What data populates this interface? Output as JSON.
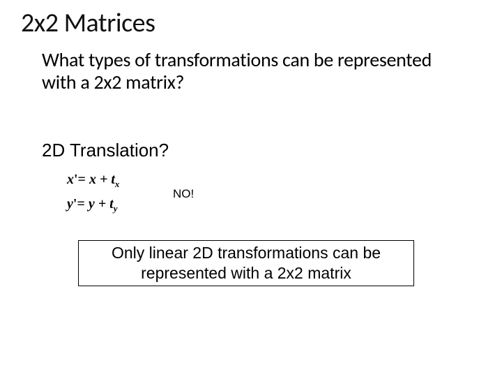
{
  "title": "2x2 Matrices",
  "subtitle": "What types of transformations can be represented with a 2x2 matrix?",
  "section": "2D Translation?",
  "eq1_lhs": "x",
  "eq1_rhs": "x + t",
  "eq1_sub": "x",
  "eq2_lhs": "y",
  "eq2_rhs": "y + t",
  "eq2_sub": "y",
  "no": "NO!",
  "box": "Only linear 2D transformations can be represented with a 2x2 matrix"
}
